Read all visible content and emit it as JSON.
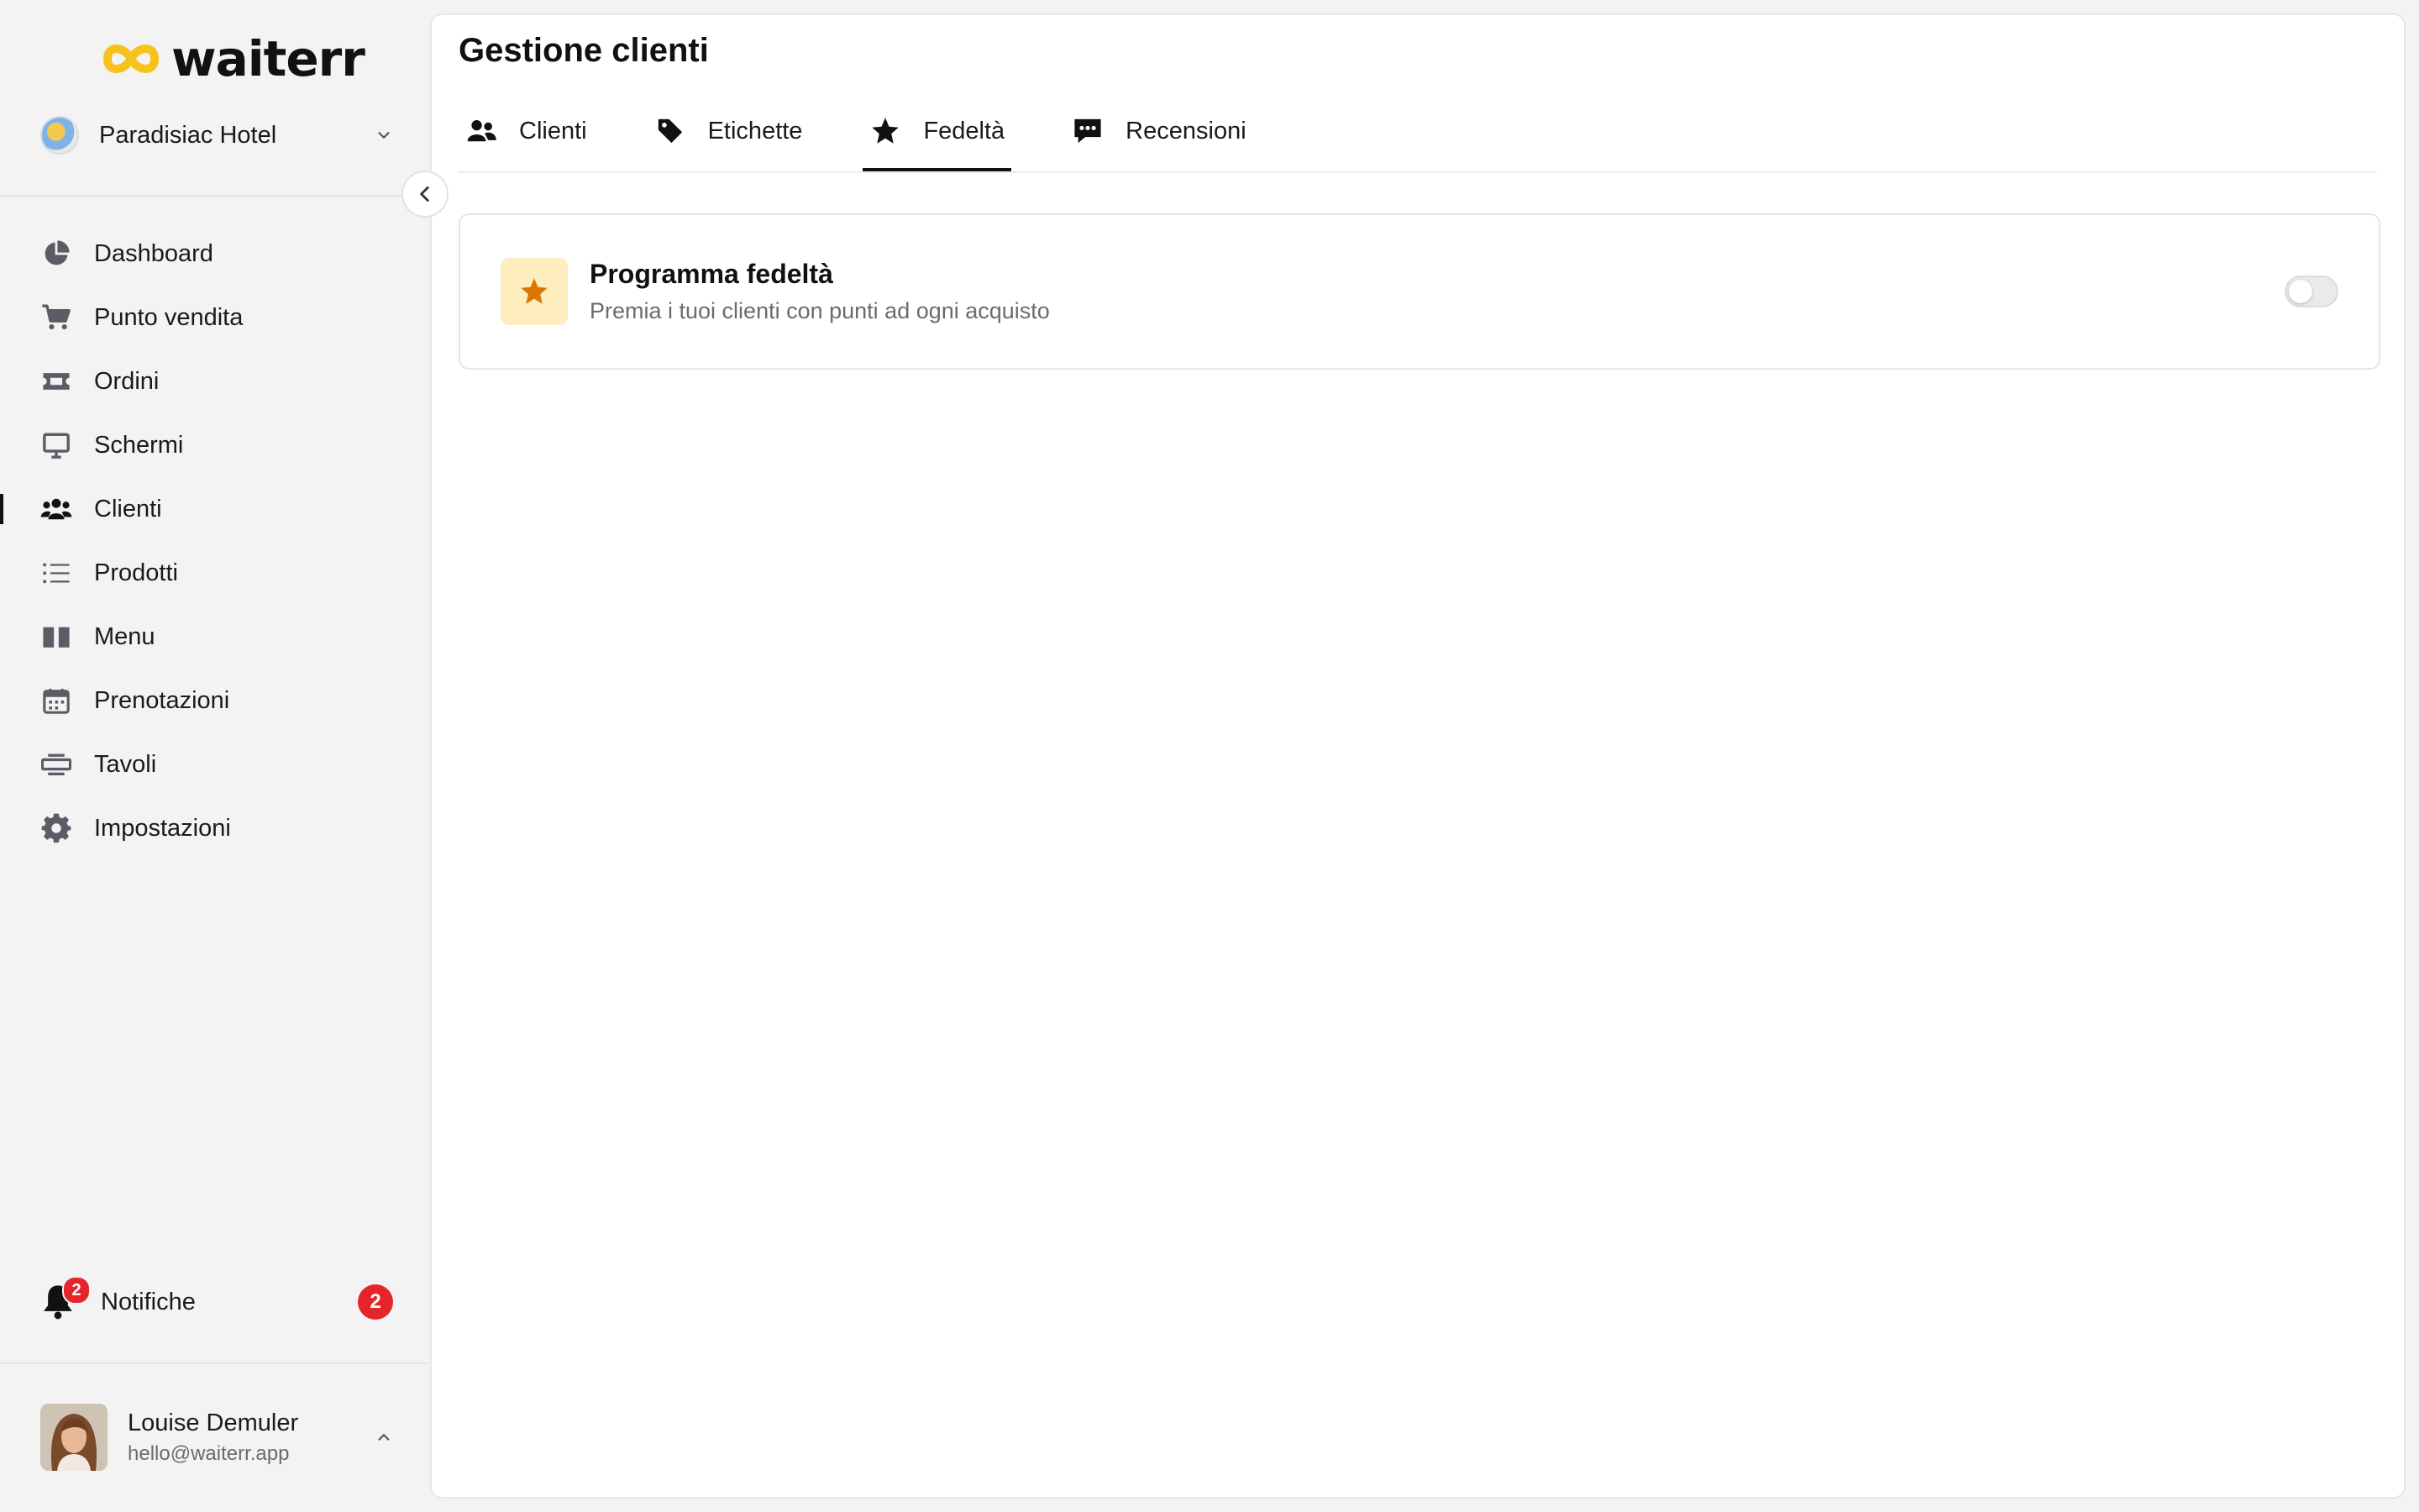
{
  "app": {
    "logo_text": "waiterr",
    "brand_color": "#f6c21c"
  },
  "venue": {
    "name": "Paradisiac Hotel"
  },
  "sidebar": {
    "items": [
      {
        "label": "Dashboard",
        "icon": "pie-chart-icon"
      },
      {
        "label": "Punto vendita",
        "icon": "cart-icon"
      },
      {
        "label": "Ordini",
        "icon": "ticket-icon"
      },
      {
        "label": "Schermi",
        "icon": "monitor-icon"
      },
      {
        "label": "Clienti",
        "icon": "users-icon",
        "active": true
      },
      {
        "label": "Prodotti",
        "icon": "list-icon"
      },
      {
        "label": "Menu",
        "icon": "book-icon"
      },
      {
        "label": "Prenotazioni",
        "icon": "calendar-icon"
      },
      {
        "label": "Tavoli",
        "icon": "table-icon"
      },
      {
        "label": "Impostazioni",
        "icon": "gear-icon"
      }
    ],
    "notifications": {
      "label": "Notifiche",
      "count": "2",
      "badge_color": "#e5242c"
    }
  },
  "user": {
    "name": "Louise Demuler",
    "email": "hello@waiterr.app"
  },
  "main": {
    "title": "Gestione clienti",
    "tabs": [
      {
        "label": "Clienti",
        "icon": "users-icon"
      },
      {
        "label": "Etichette",
        "icon": "tag-icon"
      },
      {
        "label": "Fedeltà",
        "icon": "star-icon",
        "active": true
      },
      {
        "label": "Recensioni",
        "icon": "comment-icon"
      }
    ],
    "loyalty_card": {
      "title": "Programma fedeltà",
      "subtitle": "Premia i tuoi clienti con punti ad ogni acquisto",
      "icon": "star-icon",
      "icon_color": "#d97706",
      "enabled": false
    }
  }
}
